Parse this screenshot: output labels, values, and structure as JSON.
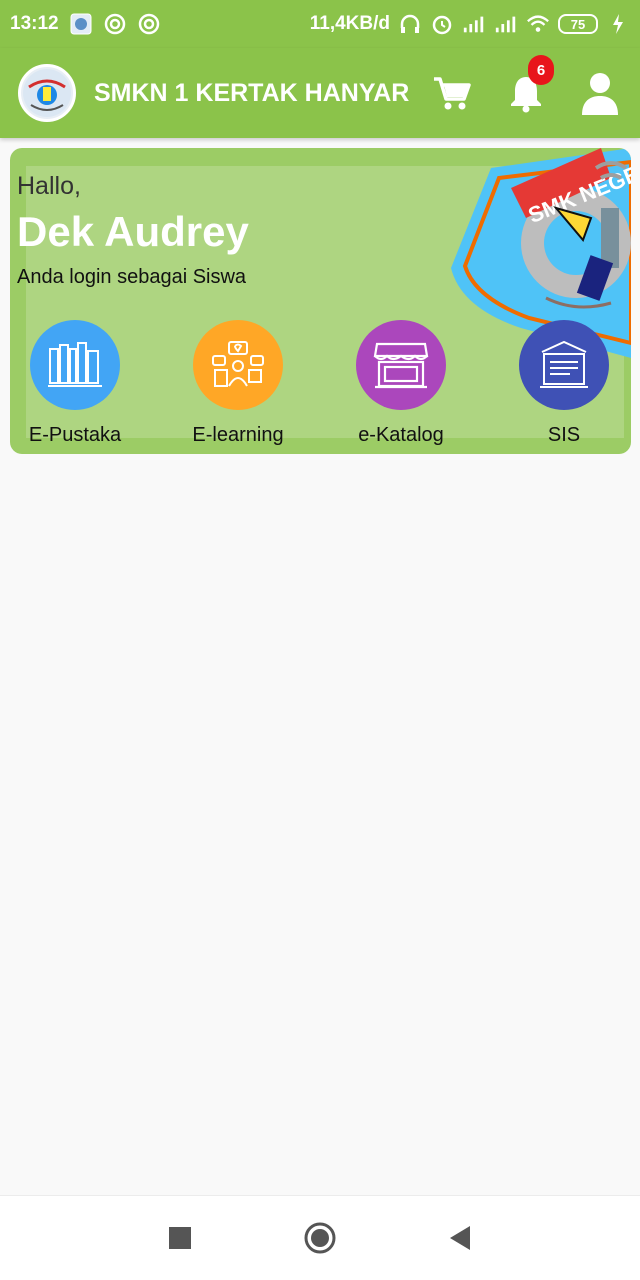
{
  "status_bar": {
    "time": "13:12",
    "net_speed": "11,4KB/d",
    "battery": "75"
  },
  "app_bar": {
    "title": "SMKN 1 KERTAK HANYAR",
    "notification_count": "6"
  },
  "hero": {
    "greeting": "Hallo,",
    "user_name": "Dek Audrey",
    "login_role": "Anda login sebagai Siswa",
    "emblem_text": "SMK NEGERI"
  },
  "menu": [
    {
      "label": "E-Pustaka",
      "icon": "library-icon",
      "color": "#42a5f5"
    },
    {
      "label": "E-learning",
      "icon": "elearning-icon",
      "color": "#ffa726"
    },
    {
      "label": "e-Katalog",
      "icon": "store-icon",
      "color": "#ab47bc"
    },
    {
      "label": "SIS",
      "icon": "school-icon",
      "color": "#3f51b5"
    }
  ],
  "colors": {
    "primary": "#8bc34a",
    "card": "#9ccc65",
    "card_inner": "#aed581",
    "badge": "#e8151b"
  }
}
